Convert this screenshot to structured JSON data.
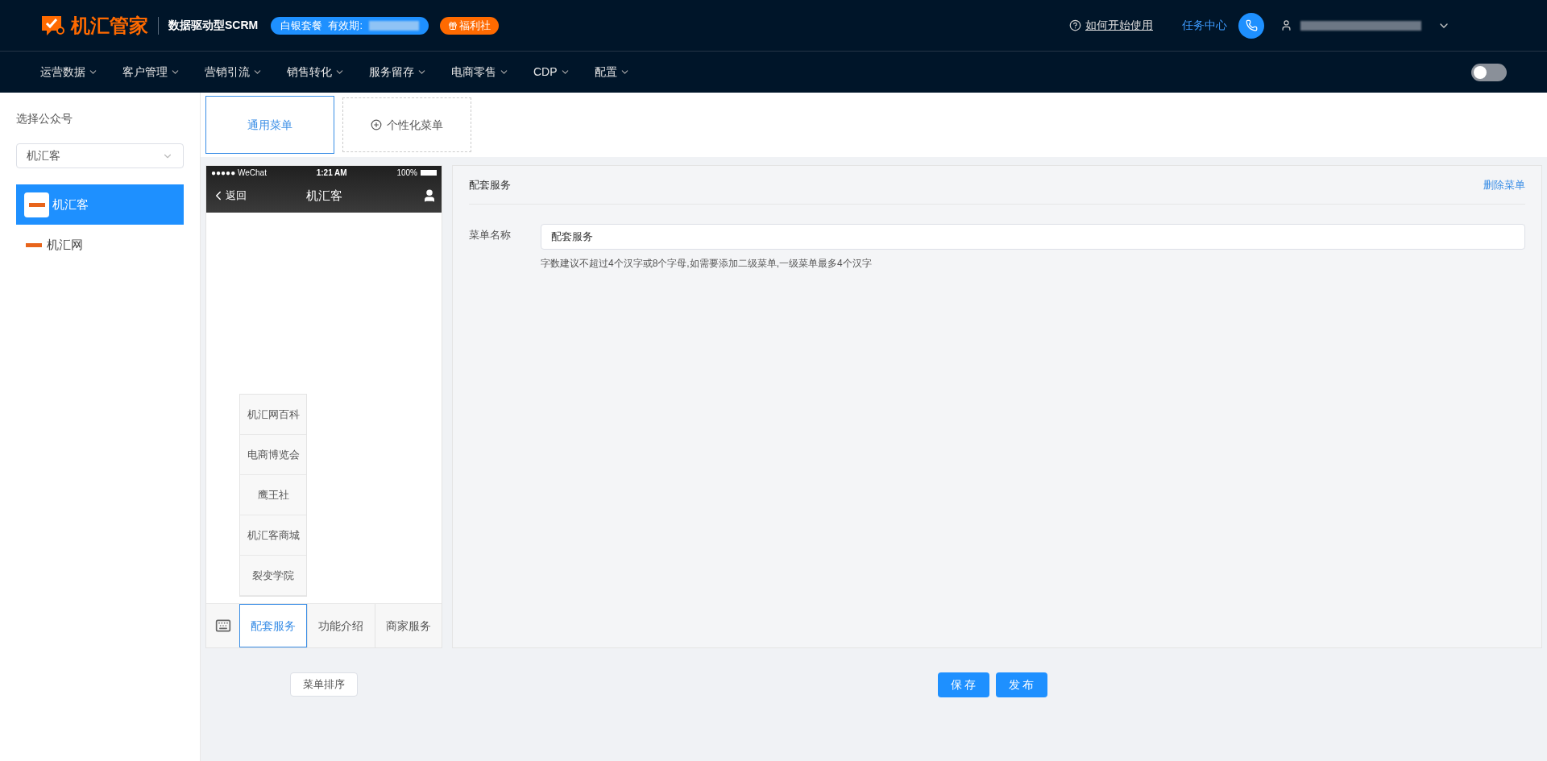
{
  "header": {
    "logo_text": "机汇管家",
    "tagline": "数据驱动型SCRM",
    "plan_badge": "白银套餐  有效期:",
    "welfare_badge": "福利社",
    "help_link": "如何开始使用",
    "task_center": "任务中心"
  },
  "nav": {
    "items": [
      {
        "label": "运营数据"
      },
      {
        "label": "客户管理"
      },
      {
        "label": "营销引流"
      },
      {
        "label": "销售转化"
      },
      {
        "label": "服务留存"
      },
      {
        "label": "电商零售"
      },
      {
        "label": "CDP"
      },
      {
        "label": "配置"
      }
    ],
    "theme_switch": {
      "on": false
    }
  },
  "sidebar": {
    "title": "选择公众号",
    "select_value": "机汇客",
    "accounts": [
      {
        "name": "机汇客",
        "selected": true
      },
      {
        "name": "机汇网",
        "selected": false
      }
    ]
  },
  "menu_tabs": [
    {
      "label": "通用菜单",
      "kind": "tab",
      "selected": true
    },
    {
      "label": "个性化菜单",
      "kind": "add",
      "selected": false
    }
  ],
  "phone": {
    "carrier": "●●●●● WeChat",
    "time": "1:21 AM",
    "battery": "100%",
    "back": "返回",
    "title": "机汇客",
    "submenu": [
      "机汇网百科",
      "电商博览会",
      "鹰王社",
      "机汇客商城",
      "裂变学院"
    ],
    "menus": [
      {
        "label": "配套服务",
        "selected": true
      },
      {
        "label": "功能介绍",
        "selected": false
      },
      {
        "label": "商家服务",
        "selected": false
      }
    ]
  },
  "editor": {
    "title": "配套服务",
    "delete_link": "删除菜单",
    "field_label": "菜单名称",
    "field_value": "配套服务",
    "hint": "字数建议不超过4个汉字或8个字母,如需要添加二级菜单,一级菜单最多4个汉字"
  },
  "footer": {
    "sort_button": "菜单排序",
    "save": "保 存",
    "publish": "发 布"
  }
}
